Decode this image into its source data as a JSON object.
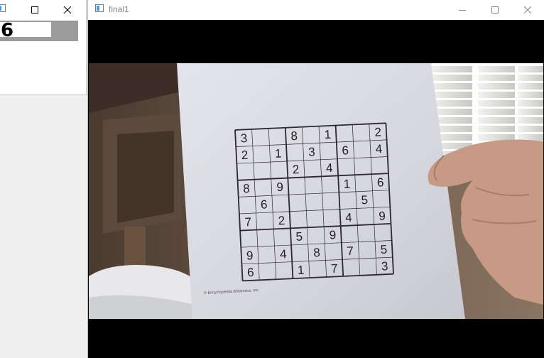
{
  "small_window": {
    "digit": "6",
    "icons": {
      "app": "app-window-icon",
      "maximize": "maximize-icon",
      "close": "close-icon"
    }
  },
  "main_window": {
    "title": "final1",
    "icons": {
      "app": "app-window-icon",
      "minimize": "minimize-icon",
      "maximize": "maximize-icon",
      "close": "close-icon"
    },
    "photo": {
      "copyright": "© Encyclopædia Britannica, Inc.",
      "sudoku": [
        [
          "3",
          "",
          "",
          "8",
          "",
          "1",
          "",
          "",
          "2"
        ],
        [
          "2",
          "",
          "1",
          "",
          "3",
          "",
          "6",
          "",
          "4"
        ],
        [
          "",
          "",
          "",
          "2",
          "",
          "4",
          "",
          "",
          ""
        ],
        [
          "8",
          "",
          "9",
          "",
          "",
          "",
          "1",
          "",
          "6"
        ],
        [
          "",
          "6",
          "",
          "",
          "",
          "",
          "",
          "5",
          ""
        ],
        [
          "7",
          "",
          "2",
          "",
          "",
          "",
          "4",
          "",
          "9"
        ],
        [
          "",
          "",
          "",
          "5",
          "",
          "9",
          "",
          "",
          ""
        ],
        [
          "9",
          "",
          "4",
          "",
          "8",
          "",
          "7",
          "",
          "5"
        ],
        [
          "6",
          "",
          "",
          "1",
          "",
          "7",
          "",
          "",
          "3"
        ]
      ]
    }
  }
}
